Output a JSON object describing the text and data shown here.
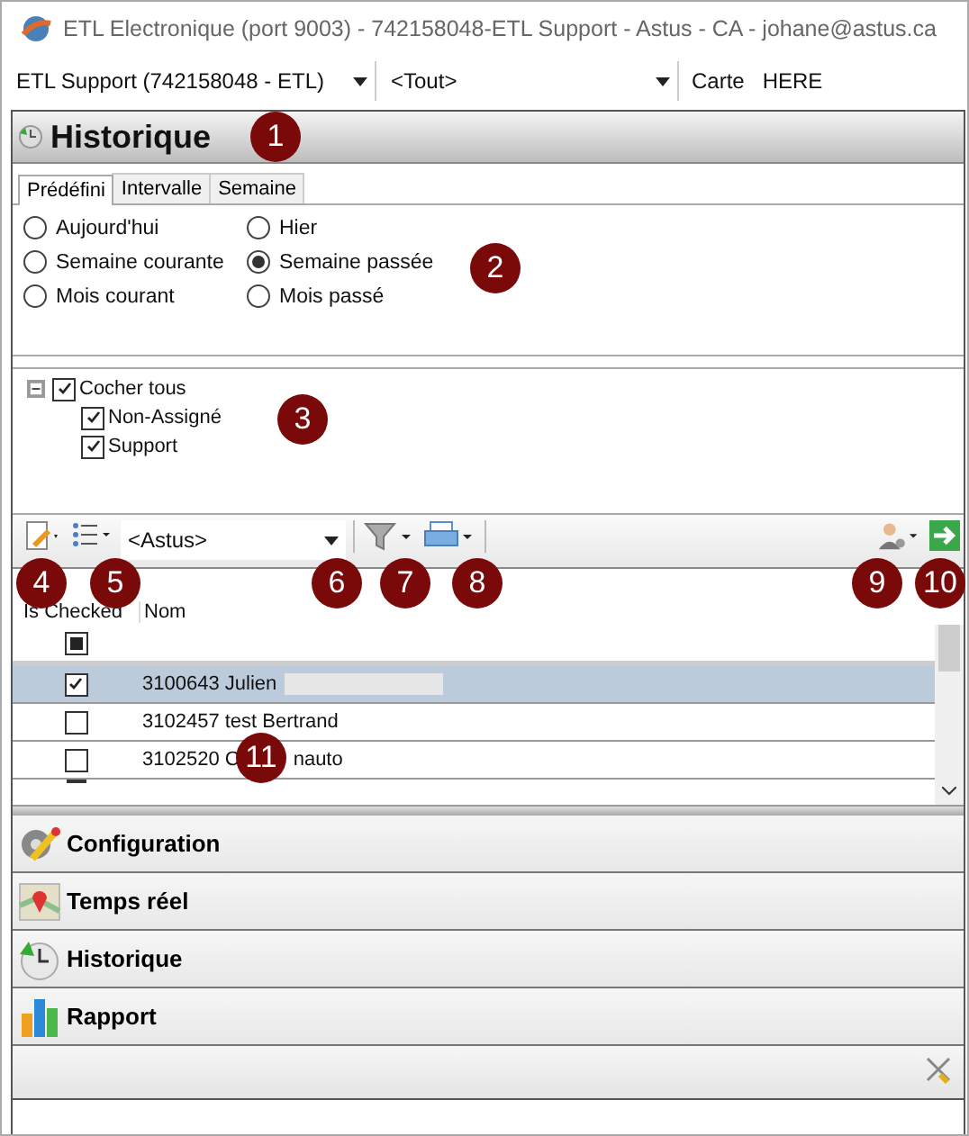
{
  "window": {
    "title": "ETL Electronique (port 9003) - 742158048-ETL Support - Astus - CA - johane@astus.ca"
  },
  "top_bar": {
    "account": "ETL Support (742158048 - ETL)",
    "group": "<Tout>",
    "map_label": "Carte",
    "map_value": "HERE"
  },
  "panel": {
    "title": "Historique"
  },
  "tabs": [
    {
      "label": "Prédéfini",
      "selected": true
    },
    {
      "label": "Intervalle",
      "selected": false
    },
    {
      "label": "Semaine",
      "selected": false
    }
  ],
  "periods": [
    {
      "label": "Aujourd'hui",
      "selected": false
    },
    {
      "label": "Hier",
      "selected": false
    },
    {
      "label": "Semaine courante",
      "selected": false
    },
    {
      "label": "Semaine passée",
      "selected": true
    },
    {
      "label": "Mois courant",
      "selected": false
    },
    {
      "label": "Mois passé",
      "selected": false
    }
  ],
  "tree": {
    "label": "Cocher tous",
    "checked": true,
    "expanded": true,
    "children": [
      {
        "label": "Non-Assigné",
        "checked": true
      },
      {
        "label": "Support",
        "checked": true
      }
    ]
  },
  "toolbar": {
    "filter": "<Astus>"
  },
  "table": {
    "columns": [
      "Is Checked",
      "Nom"
    ],
    "select_all_partial": true,
    "rows": [
      {
        "checked": true,
        "selected": true,
        "name": [
          "3100643 Julien"
        ],
        "redacted": true
      },
      {
        "checked": false,
        "selected": false,
        "name": [
          "3102457 test Bertrand"
        ],
        "redacted": false
      },
      {
        "checked": false,
        "selected": false,
        "name": [
          "3102520 C",
          "nauto"
        ],
        "redacted": false
      }
    ]
  },
  "nav": [
    {
      "label": "Configuration",
      "kind": "config"
    },
    {
      "label": "Temps réel",
      "kind": "map"
    },
    {
      "label": "Historique",
      "kind": "history"
    },
    {
      "label": "Rapport",
      "kind": "report"
    }
  ],
  "callouts": [
    "1",
    "2",
    "3",
    "4",
    "5",
    "6",
    "7",
    "8",
    "9",
    "10",
    "11"
  ]
}
